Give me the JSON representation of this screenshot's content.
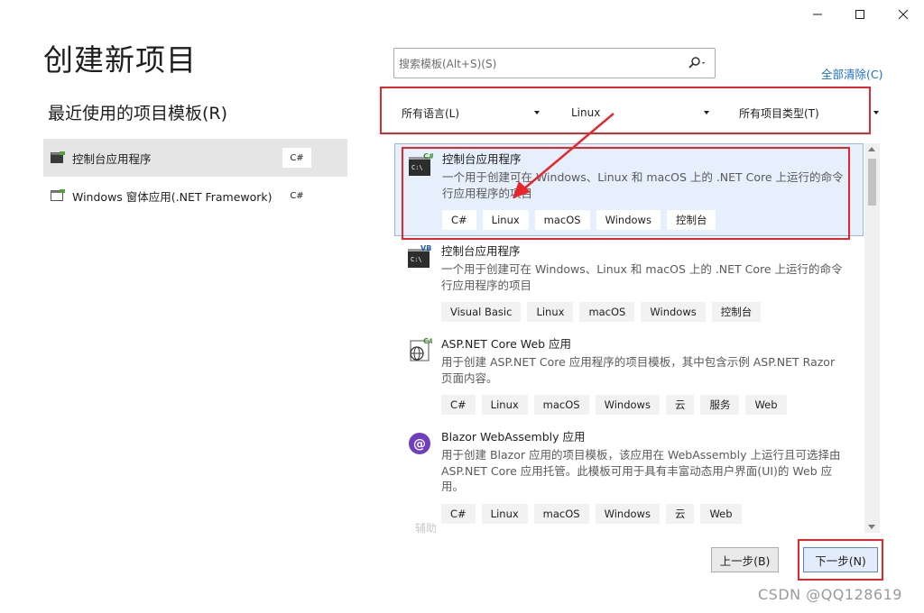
{
  "window": {
    "controls": [
      "minimize",
      "maximize",
      "close"
    ]
  },
  "page": {
    "title": "创建新项目",
    "recent_title": "最近使用的项目模板(R)"
  },
  "recent": [
    {
      "label": "控制台应用程序",
      "lang": "C#",
      "icon": "console-icon",
      "selected": true
    },
    {
      "label": "Windows 窗体应用(.NET Framework)",
      "lang": "C#",
      "icon": "window-form-icon",
      "selected": false
    }
  ],
  "search": {
    "placeholder": "搜索模板(Alt+S)(S)",
    "icon": "search-icon"
  },
  "clear_all": "全部清除(C)",
  "filters": {
    "language": "所有语言(L)",
    "platform": "Linux",
    "project_type": "所有项目类型(T)"
  },
  "templates": [
    {
      "name": "控制台应用程序",
      "desc": "一个用于创建可在 Windows、Linux 和 macOS 上的 .NET Core 上运行的命令行应用程序的项目",
      "tags": [
        "C#",
        "Linux",
        "macOS",
        "Windows",
        "控制台"
      ],
      "icon": "console-csharp-icon",
      "badge": "C#"
    },
    {
      "name": "控制台应用程序",
      "desc": "一个用于创建可在 Windows、Linux 和 macOS 上的 .NET Core 上运行的命令行应用程序的项目",
      "tags": [
        "Visual Basic",
        "Linux",
        "macOS",
        "Windows",
        "控制台"
      ],
      "icon": "console-vb-icon",
      "badge": "VB"
    },
    {
      "name": "ASP.NET Core Web 应用",
      "desc": "用于创建 ASP.NET Core 应用程序的项目模板，其中包含示例 ASP.NET Razor 页面内容。",
      "tags": [
        "C#",
        "Linux",
        "macOS",
        "Windows",
        "云",
        "服务",
        "Web"
      ],
      "icon": "globe-icon",
      "badge": "C#"
    },
    {
      "name": "Blazor WebAssembly 应用",
      "desc": "用于创建 Blazor 应用的项目模板，该应用在 WebAssembly 上运行且可选择由 ASP.NET Core 应用托管。此模板可用于具有丰富动态用户界面(UI)的 Web 应用。",
      "tags": [
        "C#",
        "Linux",
        "macOS",
        "Windows",
        "云",
        "Web"
      ],
      "icon": "blazor-icon",
      "badge": ""
    }
  ],
  "partial_item": "辅助",
  "buttons": {
    "back": "上一步(B)",
    "next": "下一步(N)"
  },
  "watermark": "CSDN @QQ128619",
  "colors": {
    "highlight": "#e8262a",
    "link": "#1a6fd1",
    "selected_bg": "#e6effc"
  }
}
